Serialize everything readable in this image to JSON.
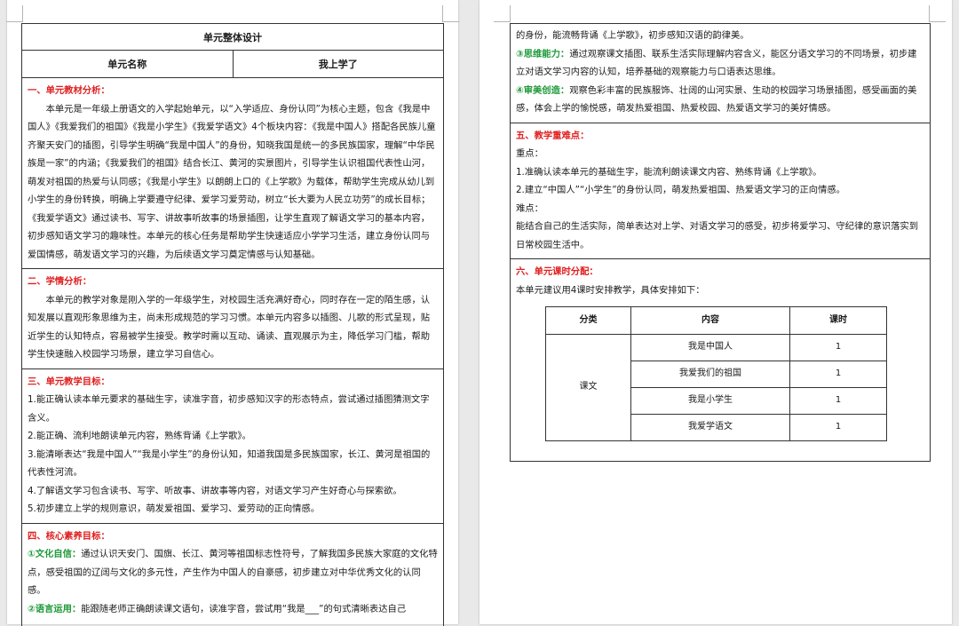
{
  "left": {
    "table_title": "单元整体设计",
    "unit_name_label": "单元名称",
    "unit_name_value": "我上学了",
    "s1": {
      "title": "一、单元教材分析：",
      "p1": "本单元是一年级上册语文的入学起始单元，以“入学适应、身份认同”为核心主题，包含《我是中国人》《我爱我们的祖国》《我是小学生》《我爱学语文》4个板块内容：《我是中国人》搭配各民族儿童齐聚天安门的插图，引导学生明确“我是中国人”的身份，知晓我国是统一的多民族国家，理解“中华民族是一家”的内涵；《我爱我们的祖国》结合长江、黄河的实景图片，引导学生认识祖国代表性山河，萌发对祖国的热爱与认同感；《我是小学生》以朗朗上口的《上学歌》为载体，帮助学生完成从幼儿到小学生的身份转换，明确上学要遵守纪律、爱学习爱劳动，树立“长大要为人民立功劳”的成长目标；《我爱学语文》通过读书、写字、讲故事听故事的场景插图，让学生直观了解语文学习的基本内容，初步感知语文学习的趣味性。本单元的核心任务是帮助学生快速适应小学学习生活，建立身份认同与爱国情感，萌发语文学习的兴趣，为后续语文学习奠定情感与认知基础。"
    },
    "s2": {
      "title": "二、学情分析：",
      "p1": "本单元的教学对象是刚入学的一年级学生，对校园生活充满好奇心，同时存在一定的陌生感，认知发展以直观形象思维为主，尚未形成规范的学习习惯。本单元内容多以插图、儿歌的形式呈现，贴近学生的认知特点，容易被学生接受。教学时需以互动、诵读、直观展示为主，降低学习门槛，帮助学生快速融入校园学习场景，建立学习自信心。"
    },
    "s3": {
      "title": "三、单元教学目标：",
      "items": [
        "1.能正确认读本单元要求的基础生字，读准字音，初步感知汉字的形态特点，尝试通过插图猜测文字含义。",
        "2.能正确、流利地朗读单元内容，熟练背诵《上学歌》。",
        "3.能清晰表达“我是中国人”“我是小学生”的身份认知，知道我国是多民族国家，长江、黄河是祖国的代表性河流。",
        "4.了解语文学习包含读书、写字、听故事、讲故事等内容，对语文学习产生好奇心与探索欲。",
        "5.初步建立上学的规则意识，萌发爱祖国、爱学习、爱劳动的正向情感。"
      ]
    },
    "s4": {
      "title": "四、核心素养目标：",
      "item1_lead": "①文化自信：",
      "item1_text": "通过认识天安门、国旗、长江、黄河等祖国标志性符号，了解我国多民族大家庭的文化特点，感受祖国的辽阔与文化的多元性，产生作为中国人的自豪感，初步建立对中华优秀文化的认同感。",
      "item2_lead": "②语言运用：",
      "item2_text": "能跟随老师正确朗读课文语句，读准字音，尝试用“我是___”的句式清晰表达自己"
    }
  },
  "right": {
    "cont_text": "的身份，能流畅背诵《上学歌》，初步感知汉语的韵律美。",
    "item3_lead": "③思维能力：",
    "item3_text": "通过观察课文插图、联系生活实际理解内容含义，能区分语文学习的不同场景，初步建立对语文学习内容的认知，培养基础的观察能力与口语表达思维。",
    "item4_lead": "④审美创造：",
    "item4_text": "观察色彩丰富的民族服饰、壮阔的山河实景、生动的校园学习场景插图，感受画面的美感，体会上学的愉悦感，萌发热爱祖国、热爱校园、热爱语文学习的美好情感。",
    "s5": {
      "title": "五、教学重难点：",
      "key_label": "重点：",
      "key_items": [
        "1.准确认读本单元的基础生字，能流利朗读课文内容、熟练背诵《上学歌》。",
        "2.建立“中国人”“小学生”的身份认同，萌发热爱祖国、热爱语文学习的正向情感。"
      ],
      "diff_label": "难点：",
      "diff_text": "能结合自己的生活实际，简单表达对上学、对语文学习的感受，初步将爱学习、守纪律的意识落实到日常校园生活中。"
    },
    "s6": {
      "title": "六、单元课时分配：",
      "intro": "本单元建议用4课时安排教学，具体安排如下：",
      "headers": [
        "分类",
        "内容",
        "课时"
      ],
      "category": "课文",
      "rows": [
        {
          "content": "我是中国人",
          "hours": "1"
        },
        {
          "content": "我爱我们的祖国",
          "hours": "1"
        },
        {
          "content": "我是小学生",
          "hours": "1"
        },
        {
          "content": "我爱学语文",
          "hours": "1"
        }
      ]
    }
  }
}
